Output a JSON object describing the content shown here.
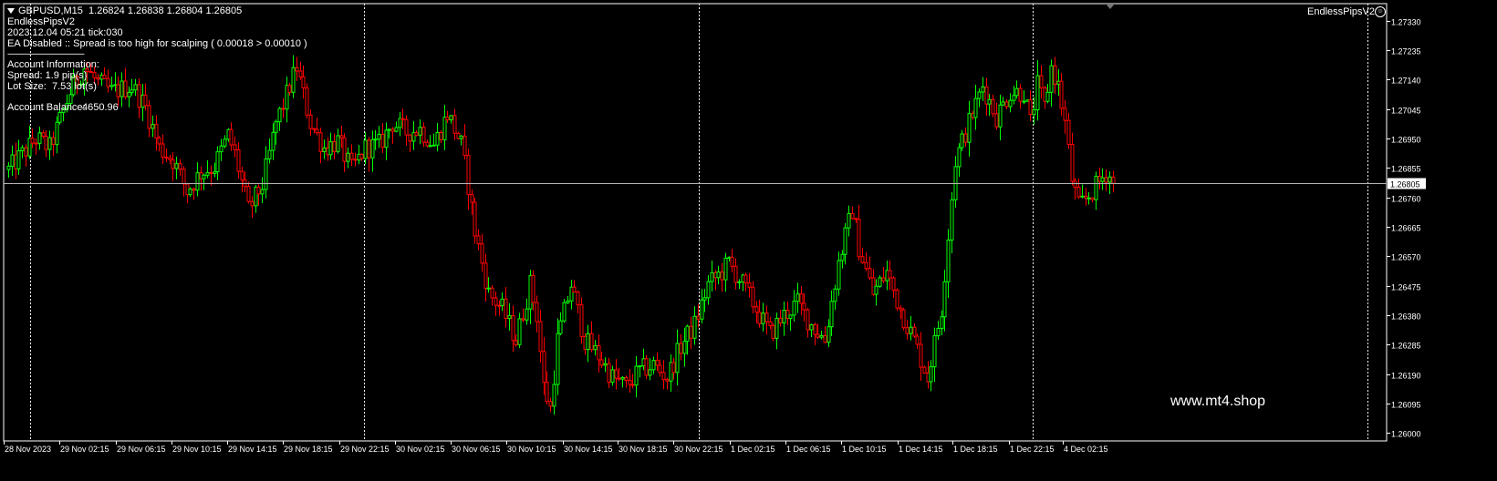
{
  "header": {
    "symbol_line": "GBPUSD,M15  1.26824 1.26838 1.26804 1.26805",
    "ea_name": "EndlessPipsV2",
    "time_line": "2023.12.04 05:21 tick:030",
    "status_line": "EA Disabled :: Spread is too high for scalping ( 0.00018 > 0.00010 )",
    "separator": "------------------------------------------",
    "account_title": "Account Information:",
    "spread_line": "Spread: 1.9 pip(s)",
    "lot_label": "Lot Size:",
    "lot_value": "7.53 lot(s)",
    "balance_label": "Account Balance:",
    "balance_value": "4650.96"
  },
  "top_right_ea": "EndlessPipsV2",
  "smiley_icon": "smiley-icon",
  "watermark": "www.mt4.shop",
  "colors": {
    "bull": "#00ff00",
    "bear": "#ff0000",
    "grid": "#ffffff",
    "axis": "#ffffff",
    "bid_line": "#b4b4b4",
    "background": "#000000"
  },
  "chart_data": {
    "type": "candlestick",
    "symbol": "GBPUSD",
    "timeframe": "M15",
    "y_ticks": [
      1.2733,
      1.27235,
      1.2714,
      1.27045,
      1.2695,
      1.26855,
      1.2676,
      1.26665,
      1.2657,
      1.26475,
      1.2638,
      1.26285,
      1.2619,
      1.26095,
      1.26
    ],
    "ylim": [
      1.25975,
      1.27385
    ],
    "current_price": 1.26805,
    "current_price_label": "1.26805",
    "x_labels": [
      "28 Nov 2023",
      "29 Nov 02:15",
      "29 Nov 06:15",
      "29 Nov 10:15",
      "29 Nov 14:15",
      "29 Nov 18:15",
      "29 Nov 22:15",
      "30 Nov 02:15",
      "30 Nov 06:15",
      "30 Nov 10:15",
      "30 Nov 14:15",
      "30 Nov 18:15",
      "30 Nov 22:15",
      "1 Dec 02:15",
      "1 Dec 06:15",
      "1 Dec 10:15",
      "1 Dec 14:15",
      "1 Dec 18:15",
      "1 Dec 22:15",
      "4 Dec 02:15"
    ],
    "day_separators": [
      "29 Nov 00:00",
      "30 Nov 00:00",
      "1 Dec 00:00",
      "4 Dec 00:00"
    ],
    "close_path": [
      [
        0,
        1.2685
      ],
      [
        8,
        1.2695
      ],
      [
        12,
        1.2692
      ],
      [
        18,
        1.271
      ],
      [
        22,
        1.2718
      ],
      [
        26,
        1.2713
      ],
      [
        30,
        1.271
      ],
      [
        36,
        1.2712
      ],
      [
        40,
        1.2705
      ],
      [
        44,
        1.2692
      ],
      [
        48,
        1.2688
      ],
      [
        52,
        1.2678
      ],
      [
        56,
        1.2684
      ],
      [
        60,
        1.2686
      ],
      [
        64,
        1.2696
      ],
      [
        66,
        1.269
      ],
      [
        70,
        1.2672
      ],
      [
        74,
        1.268
      ],
      [
        78,
        1.27
      ],
      [
        84,
        1.2718
      ],
      [
        88,
        1.27
      ],
      [
        92,
        1.2692
      ],
      [
        96,
        1.2694
      ],
      [
        100,
        1.2685
      ],
      [
        104,
        1.2692
      ],
      [
        108,
        1.2693
      ],
      [
        112,
        1.27
      ],
      [
        116,
        1.2697
      ],
      [
        120,
        1.2698
      ],
      [
        124,
        1.2693
      ],
      [
        128,
        1.2703
      ],
      [
        132,
        1.2693
      ],
      [
        134,
        1.268
      ],
      [
        136,
        1.2665
      ],
      [
        140,
        1.2645
      ],
      [
        144,
        1.264
      ],
      [
        148,
        1.263
      ],
      [
        152,
        1.2648
      ],
      [
        154,
        1.2638
      ],
      [
        156,
        1.2615
      ],
      [
        158,
        1.2608
      ],
      [
        160,
        1.263
      ],
      [
        164,
        1.2648
      ],
      [
        168,
        1.263
      ],
      [
        172,
        1.2625
      ],
      [
        176,
        1.2618
      ],
      [
        180,
        1.2615
      ],
      [
        184,
        1.262
      ],
      [
        188,
        1.2622
      ],
      [
        192,
        1.2618
      ],
      [
        196,
        1.2628
      ],
      [
        200,
        1.2635
      ],
      [
        204,
        1.2648
      ],
      [
        208,
        1.2652
      ],
      [
        210,
        1.2655
      ],
      [
        214,
        1.2648
      ],
      [
        218,
        1.264
      ],
      [
        222,
        1.2632
      ],
      [
        226,
        1.2638
      ],
      [
        230,
        1.2642
      ],
      [
        234,
        1.2635
      ],
      [
        238,
        1.263
      ],
      [
        242,
        1.2655
      ],
      [
        246,
        1.2672
      ],
      [
        248,
        1.266
      ],
      [
        252,
        1.2645
      ],
      [
        256,
        1.2652
      ],
      [
        260,
        1.264
      ],
      [
        264,
        1.263
      ],
      [
        268,
        1.2618
      ],
      [
        272,
        1.264
      ],
      [
        276,
        1.2688
      ],
      [
        280,
        1.27
      ],
      [
        284,
        1.2712
      ],
      [
        288,
        1.2702
      ],
      [
        292,
        1.271
      ],
      [
        296,
        1.271
      ],
      [
        298,
        1.27
      ],
      [
        300,
        1.2712
      ],
      [
        302,
        1.2705
      ],
      [
        304,
        1.2718
      ],
      [
        306,
        1.2712
      ],
      [
        308,
        1.27
      ],
      [
        310,
        1.2682
      ],
      [
        312,
        1.2673
      ],
      [
        316,
        1.2678
      ],
      [
        320,
        1.2684
      ],
      [
        322,
        1.2682
      ]
    ]
  }
}
